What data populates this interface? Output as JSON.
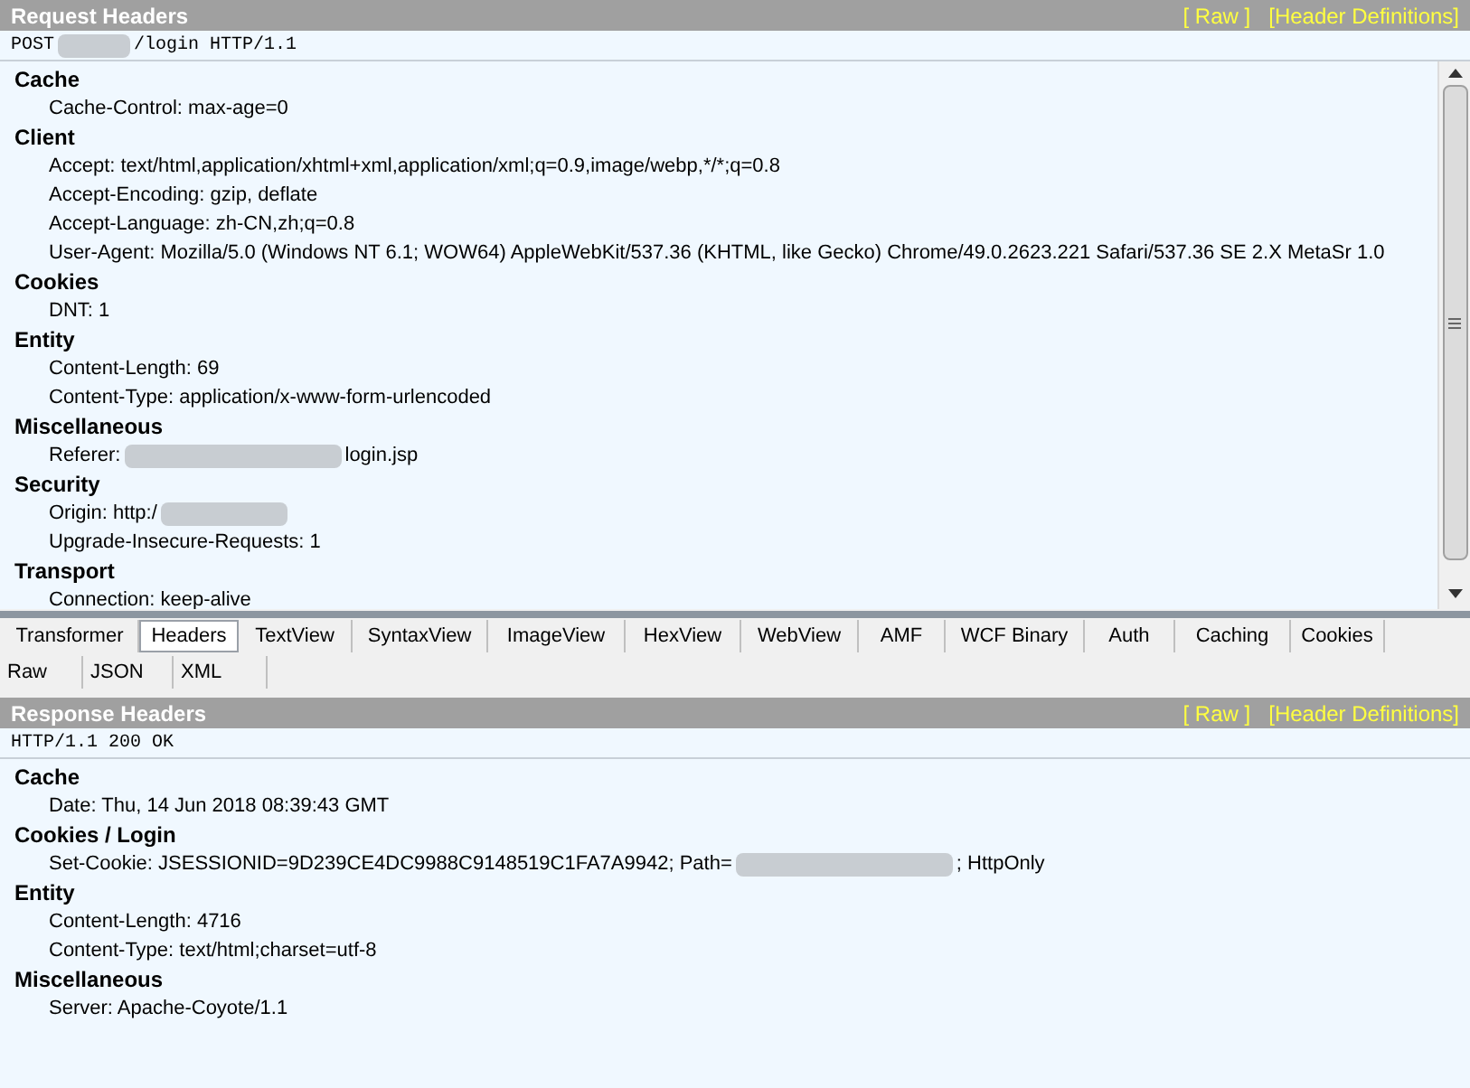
{
  "request": {
    "title": "Request Headers",
    "links": [
      "[ Raw ]",
      "[Header Definitions]"
    ],
    "request_line": {
      "text": "POST",
      "redacted": true,
      "text_after": "/login HTTP/1.1"
    },
    "groups": [
      {
        "name": "Cache",
        "headers": [
          {
            "text": "Cache-Control: max-age=0",
            "redacted": false
          }
        ]
      },
      {
        "name": "Client",
        "headers": [
          {
            "text": "Accept: text/html,application/xhtml+xml,application/xml;q=0.9,image/webp,*/*;q=0.8",
            "redacted": false
          },
          {
            "text": "Accept-Encoding: gzip, deflate",
            "redacted": false
          },
          {
            "text": "Accept-Language: zh-CN,zh;q=0.8",
            "redacted": false
          },
          {
            "text": "User-Agent: Mozilla/5.0 (Windows NT 6.1; WOW64) AppleWebKit/537.36 (KHTML, like Gecko) Chrome/49.0.2623.221 Safari/537.36 SE 2.X MetaSr 1.0",
            "redacted": false
          }
        ]
      },
      {
        "name": "Cookies",
        "headers": [
          {
            "text": "DNT: 1",
            "redacted": false
          }
        ]
      },
      {
        "name": "Entity",
        "headers": [
          {
            "text": "Content-Length: 69",
            "redacted": false
          },
          {
            "text": "Content-Type: application/x-www-form-urlencoded",
            "redacted": false
          }
        ]
      },
      {
        "name": "Miscellaneous",
        "headers": [
          {
            "text": "Referer:",
            "redacted": true,
            "text_after": "login.jsp"
          }
        ]
      },
      {
        "name": "Security",
        "headers": [
          {
            "text": "Origin: http:/",
            "redacted": true
          },
          {
            "text": "Upgrade-Insecure-Requests: 1",
            "redacted": false
          }
        ]
      },
      {
        "name": "Transport",
        "headers": [
          {
            "text": "Connection: keep-alive",
            "redacted": false
          }
        ]
      }
    ]
  },
  "tabs": [
    {
      "label": "Transformer",
      "selected": false
    },
    {
      "label": "Headers",
      "selected": true
    },
    {
      "label": "TextView",
      "selected": false
    },
    {
      "label": "SyntaxView",
      "selected": false
    },
    {
      "label": "ImageView",
      "selected": false
    },
    {
      "label": "HexView",
      "selected": false
    },
    {
      "label": "WebView",
      "selected": false
    },
    {
      "label": "AMF",
      "selected": false
    },
    {
      "label": "WCF Binary",
      "selected": false
    },
    {
      "label": "Auth",
      "selected": false
    },
    {
      "label": "Caching",
      "selected": false
    },
    {
      "label": "Cookies",
      "selected": false
    }
  ],
  "subtabs": [
    {
      "label": "Raw",
      "selected": false
    },
    {
      "label": "JSON",
      "selected": false
    },
    {
      "label": "XML",
      "selected": false
    }
  ],
  "response": {
    "title": "Response Headers",
    "links": [
      "[ Raw ]",
      "[Header Definitions]"
    ],
    "request_line": {
      "text": "HTTP/1.1 200 OK",
      "redacted": false
    },
    "groups": [
      {
        "name": "Cache",
        "headers": [
          {
            "text": "Date: Thu, 14 Jun 2018 08:39:43 GMT",
            "redacted": false
          }
        ]
      },
      {
        "name": "Cookies / Login",
        "headers": [
          {
            "text": "Set-Cookie: JSESSIONID=9D239CE4DC9988C9148519C1FA7A9942; Path=",
            "redacted": true,
            "text_after": "; HttpOnly"
          }
        ]
      },
      {
        "name": "Entity",
        "headers": [
          {
            "text": "Content-Length: 4716",
            "redacted": false
          },
          {
            "text": "Content-Type: text/html;charset=utf-8",
            "redacted": false
          }
        ]
      },
      {
        "name": "Miscellaneous",
        "headers": [
          {
            "text": "Server: Apache-Coyote/1.1",
            "redacted": false
          }
        ]
      }
    ]
  }
}
